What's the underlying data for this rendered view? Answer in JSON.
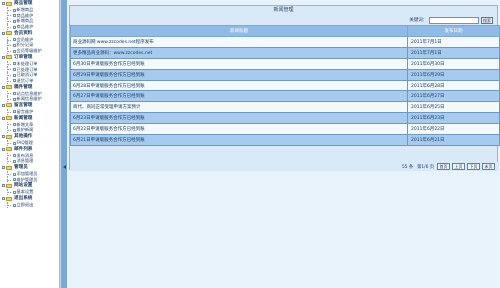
{
  "sidebar": {
    "groups": [
      {
        "title": "商品管理",
        "items": [
          "新增商品",
          "商品维护",
          "新增商品",
          "商品维护"
        ]
      },
      {
        "title": "会员资料",
        "items": [
          "会员维护",
          "积分记录",
          "会员等级维护"
        ]
      },
      {
        "title": "订单管理",
        "items": [
          "未处理订单",
          "已处理订单",
          "已取消订单",
          "退货订单"
        ]
      },
      {
        "title": "稿件管理",
        "items": [
          "站点信息维护",
          "新闻信息维护"
        ]
      },
      {
        "title": "留言管理",
        "items": [
          "留言维护"
        ]
      },
      {
        "title": "新闻管理",
        "items": [
          "新增文章",
          "维护新闻"
        ]
      },
      {
        "title": "其他操作",
        "items": [
          "FAQ管理"
        ]
      },
      {
        "title": "邮件列表",
        "items": [
          "发布消息",
          "消息管理"
        ]
      },
      {
        "title": "管理员",
        "items": [
          "添加管理员",
          "维护管理员"
        ]
      },
      {
        "title": "网站设置",
        "items": [
          "基本设置"
        ]
      },
      {
        "title": "退出系统",
        "items": [
          "立即退出"
        ]
      }
    ]
  },
  "panel": {
    "title": "新闻管理",
    "search_label": "关键词：",
    "search_button": "搜索"
  },
  "table": {
    "headers": [
      "新闻标题",
      "发布日期"
    ],
    "rows": [
      {
        "title": "商业源码网 www.zzcodes.net程序发布",
        "date": "2011年7月1日"
      },
      {
        "title": "更多精品商业源码：www.zzcodes.net",
        "date": "2011年7月1日"
      },
      {
        "title": "6月30日申请版服务合作方已经到账",
        "date": "2011年6月30日"
      },
      {
        "title": "6月29日申请版服务合作方已经到账",
        "date": "2011年6月29日"
      },
      {
        "title": "6月28日申请版服务合作方已经到账",
        "date": "2011年6月28日"
      },
      {
        "title": "6月27日申请版服务合作方已经到账",
        "date": "2011年6月27日"
      },
      {
        "title": "商代、商同正常受理申请方案预计",
        "date": "2011年6月25日"
      },
      {
        "title": "6月23日申请版服务合作方已经到账",
        "date": "2011年6月23日"
      },
      {
        "title": "6月22日申请版服务合作方已经到账",
        "date": "2011年6月22日"
      },
      {
        "title": "6月21日申请版服务合作方已经到账",
        "date": "2011年6月21日"
      }
    ]
  },
  "pager": {
    "count": "55 条",
    "page_info": "第1/6 页",
    "first": "首页",
    "prev": "上页",
    "next": "下页",
    "last": "末页"
  }
}
